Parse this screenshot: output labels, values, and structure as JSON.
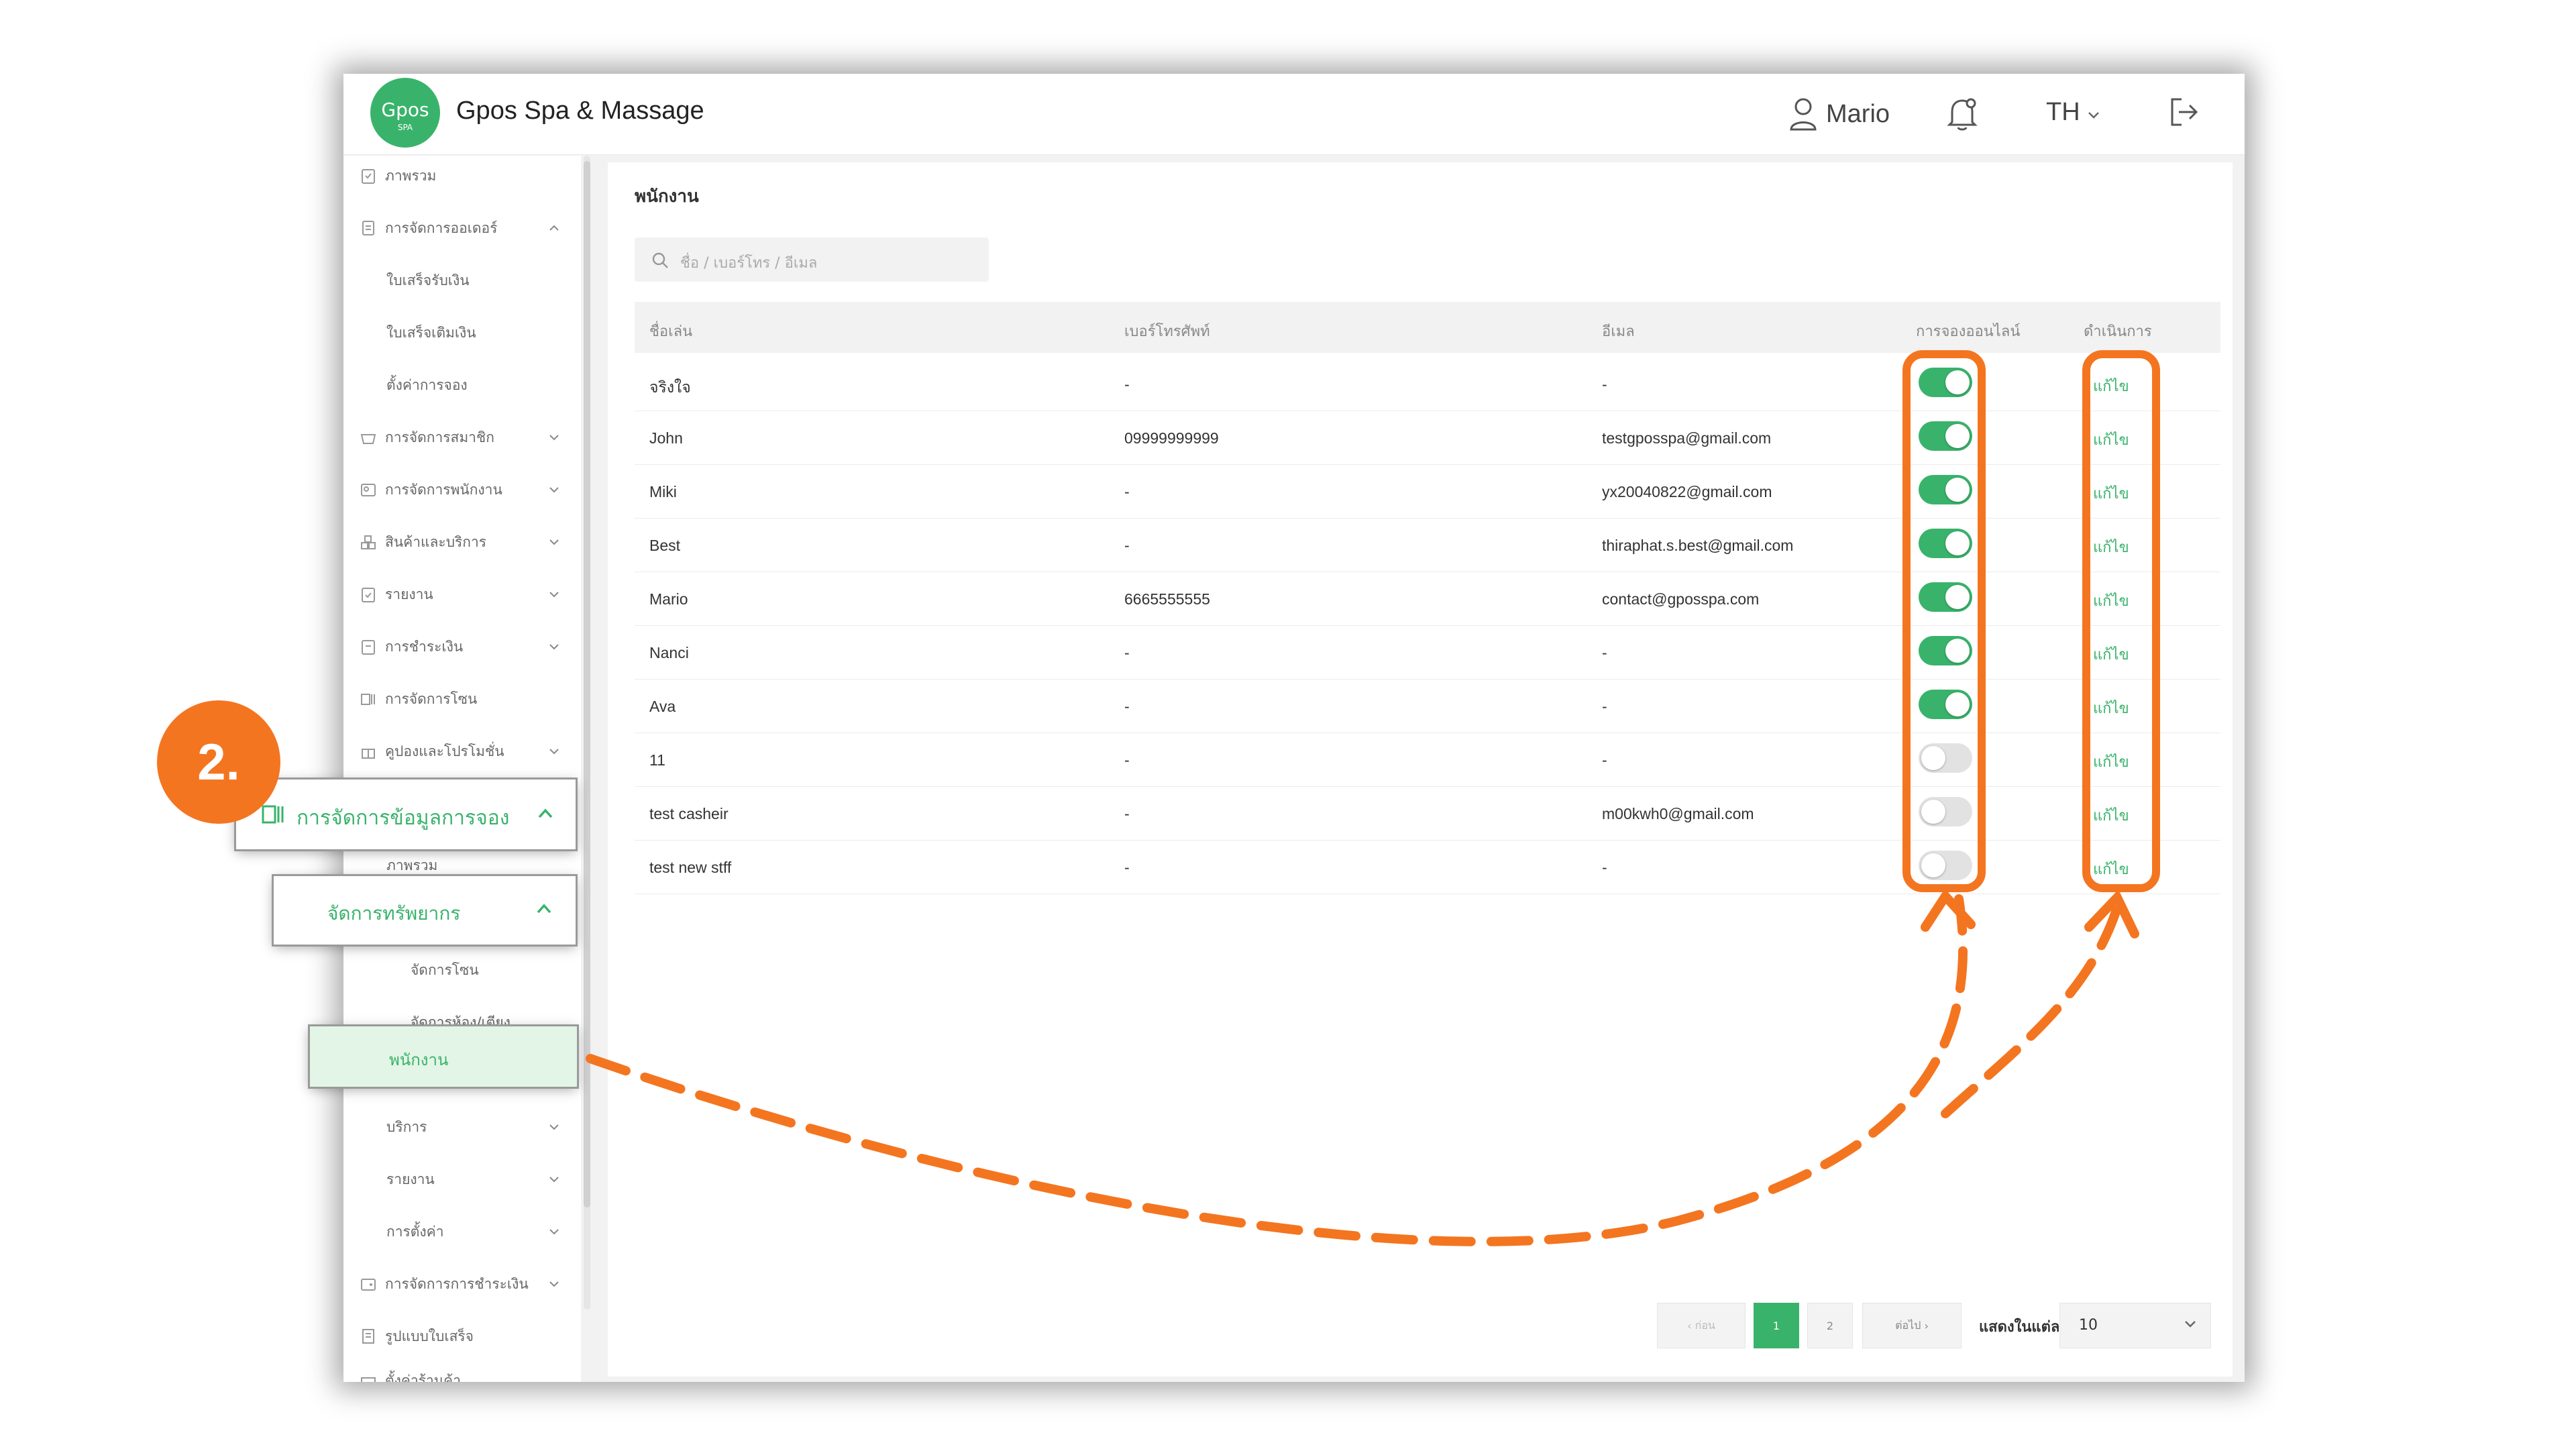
{
  "app": {
    "logo_text": "Gpos",
    "logo_sub": "SPA",
    "title": "Gpos Spa & Massage"
  },
  "header": {
    "user": "Mario",
    "lang": "TH"
  },
  "sidebar": {
    "items": [
      {
        "label": "ภาพรวม",
        "icon": "clipboard-icon"
      },
      {
        "label": "การจัดการออเดอร์",
        "icon": "document-icon"
      },
      {
        "label": "ใบเสร็จรับเงิน"
      },
      {
        "label": "ใบเสร็จเติมเงิน"
      },
      {
        "label": "ตั้งค่าการจอง"
      },
      {
        "label": "การจัดการสมาชิก",
        "icon": "basket-icon"
      },
      {
        "label": "การจัดการพนักงาน",
        "icon": "id-card-icon"
      },
      {
        "label": "สินค้าและบริการ",
        "icon": "boxes-icon"
      },
      {
        "label": "รายงาน",
        "icon": "report-icon"
      },
      {
        "label": "การชำระเงิน",
        "icon": "payment-icon"
      },
      {
        "label": "การจัดการโซน",
        "icon": "zone-icon"
      },
      {
        "label": "คูปองและโปรโมชั่น",
        "icon": "gift-icon"
      },
      {
        "label": "ภาพรวม"
      },
      {
        "label": "จัดการโซน"
      },
      {
        "label": "จัดการห้อง/เตียง"
      },
      {
        "label": "บริการ"
      },
      {
        "label": "รายงาน"
      },
      {
        "label": "การตั้งค่า"
      },
      {
        "label": "การจัดการการชำระเงิน",
        "icon": "wallet-icon"
      },
      {
        "label": "รูปแบบใบเสร็จ",
        "icon": "receipt-icon"
      },
      {
        "label": "ตั้งค่าร้านค้า",
        "icon": "store-icon"
      }
    ],
    "callout_booking": "การจัดการข้อมูลการจอง",
    "callout_resource": "จัดการทรัพยากร",
    "callout_staff": "พนักงาน"
  },
  "main": {
    "title": "พนักงาน",
    "search_placeholder": "ชื่อ / เบอร์โทร / อีเมล",
    "columns": [
      "ชื่อเล่น",
      "เบอร์โทรศัพท์",
      "อีเมล",
      "การจองออนไลน์",
      "ดำเนินการ"
    ],
    "rows": [
      {
        "name": "จริงใจ",
        "phone": "-",
        "email": "-",
        "online": true,
        "action": "แก้ไข"
      },
      {
        "name": "John",
        "phone": "09999999999",
        "email": "testgposspa@gmail.com",
        "online": true,
        "action": "แก้ไข"
      },
      {
        "name": "Miki",
        "phone": "-",
        "email": "yx20040822@gmail.com",
        "online": true,
        "action": "แก้ไข"
      },
      {
        "name": "Best",
        "phone": "-",
        "email": "thiraphat.s.best@gmail.com",
        "online": true,
        "action": "แก้ไข"
      },
      {
        "name": "Mario",
        "phone": "6665555555",
        "email": "contact@gposspa.com",
        "online": true,
        "action": "แก้ไข"
      },
      {
        "name": "Nanci",
        "phone": "-",
        "email": "-",
        "online": true,
        "action": "แก้ไข"
      },
      {
        "name": "Ava",
        "phone": "-",
        "email": "-",
        "online": true,
        "action": "แก้ไข"
      },
      {
        "name": "11",
        "phone": "-",
        "email": "-",
        "online": false,
        "action": "แก้ไข"
      },
      {
        "name": "test casheir",
        "phone": "-",
        "email": "m00kwh0@gmail.com",
        "online": false,
        "action": "แก้ไข"
      },
      {
        "name": "test new stff",
        "phone": "-",
        "email": "-",
        "online": false,
        "action": "แก้ไข"
      }
    ]
  },
  "pagination": {
    "prev": "ก่อน",
    "pages": [
      "1",
      "2"
    ],
    "current": "1",
    "next": "ต่อไป",
    "page_size_label": "แสดงในแต่ละหน้า",
    "page_size": "10"
  },
  "annotation": {
    "step": "2.",
    "color": "#f47520"
  },
  "colors": {
    "accent": "#39b36b"
  }
}
